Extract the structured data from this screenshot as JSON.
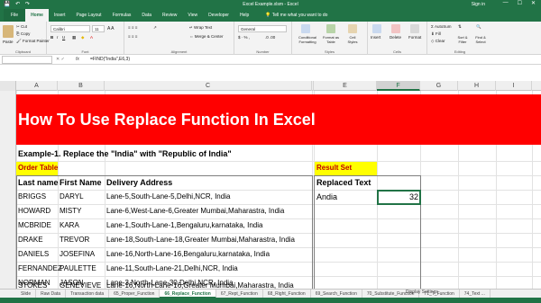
{
  "window": {
    "title": "Excel Example.xlsm  -  Excel",
    "sign_in": "Sign in",
    "min": "—",
    "max": "☐",
    "close": "✕"
  },
  "tabs": {
    "file": "File",
    "home": "Home",
    "insert": "Insert",
    "page_layout": "Page Layout",
    "formulas": "Formulas",
    "data": "Data",
    "review": "Review",
    "view": "View",
    "developer": "Developer",
    "help": "Help",
    "tell": "Tell me what you want to do"
  },
  "ribbon": {
    "clipboard": {
      "cut": "Cut",
      "copy": "Copy",
      "format_painter": "Format Painter",
      "paste": "Paste",
      "group": "Clipboard"
    },
    "font": {
      "name": "Calibri",
      "size": "11",
      "bold": "B",
      "italic": "I",
      "underline": "U",
      "group": "Font"
    },
    "alignment": {
      "wrap": "Wrap Text",
      "merge": "Merge & Center",
      "group": "Alignment"
    },
    "number": {
      "format": "General",
      "group": "Number"
    },
    "styles": {
      "cond": "Conditional Formatting",
      "table": "Format as Table",
      "cell": "Cell Styles",
      "group": "Styles"
    },
    "cells": {
      "insert": "Insert",
      "delete": "Delete",
      "format": "Format",
      "group": "Cells"
    },
    "editing": {
      "autosum": "AutoSum",
      "fill": "Fill",
      "clear": "Clear",
      "sort": "Sort & Filter",
      "find": "Find & Select",
      "group": "Editing"
    }
  },
  "formula_bar": {
    "fx": "fx",
    "formula": "=FIND(\"India\",E6,3)"
  },
  "columns": [
    "A",
    "B",
    "C",
    "D",
    "E",
    "F",
    "G",
    "H",
    "I"
  ],
  "selected_column": "F",
  "sheet": {
    "banner": "How To Use  Replace  Function In Excel",
    "example": "Example-1. Replace the \"India\"  with \"Republic of India\"",
    "order_table": "Order Table",
    "result_set": "Result Set",
    "headers": {
      "last": "Last name",
      "first": "First Name",
      "address": "Delivery Address",
      "replaced": "Replaced Text"
    },
    "result_value": "Andia",
    "result_number": "32",
    "rows": [
      {
        "last": "BRIGGS",
        "first": "DARYL",
        "address": "Lane-5,South-Lane-5,Delhi,NCR, India"
      },
      {
        "last": "HOWARD",
        "first": "MISTY",
        "address": "Lane-6,West-Lane-6,Greater Mumbai,Maharastra, India"
      },
      {
        "last": "MCBRIDE",
        "first": "KARA",
        "address": "Lane-1,South-Lane-1,Bengaluru,karnataka, India"
      },
      {
        "last": "DRAKE",
        "first": "TREVOR",
        "address": "Lane-18,South-Lane-18,Greater Mumbai,Maharastra, India"
      },
      {
        "last": "DANIELS",
        "first": "JOSEFINA",
        "address": "Lane-16,North-Lane-16,Bengaluru,karnataka, India"
      },
      {
        "last": "FERNANDEZ",
        "first": "PAULETTE",
        "address": "Lane-11,South-Lane-21,Delhi,NCR, India"
      },
      {
        "last": "NORMAN",
        "first": "JASON",
        "address": "Lane-3,North-Lane-30,Delhi,NCR, India"
      },
      {
        "last": "STOKES",
        "first": "GENEVIEVE",
        "address": "Lane-16,North-Lane-16,Greater Mumbai,Maharastra, India"
      }
    ]
  },
  "sheet_tabs": [
    "Slide",
    "Raw Data",
    "Transaction data",
    "65_Proper_Function",
    "66_Replace_Function",
    "67_Rept_Function",
    "68_Right_Function",
    "69_Search_Function",
    "70_Substitute_Function",
    "71_T_Function",
    "74_Text ..."
  ],
  "active_sheet": "66_Replace_Function",
  "status": {
    "display_settings": "Display Settings"
  },
  "colors": {
    "excel_green": "#217346",
    "banner_red": "#ff0000",
    "highlight_yellow": "#ffff00"
  }
}
